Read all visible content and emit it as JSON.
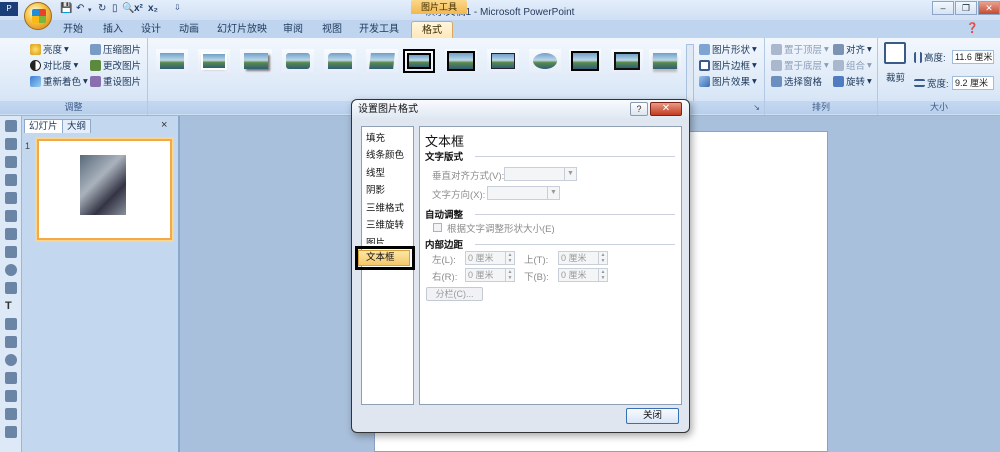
{
  "app": {
    "title": "演示文稿1 - Microsoft PowerPoint",
    "tool_context": "图片工具"
  },
  "tabs": [
    {
      "label": "开始"
    },
    {
      "label": "插入"
    },
    {
      "label": "设计"
    },
    {
      "label": "动画"
    },
    {
      "label": "幻灯片放映"
    },
    {
      "label": "审阅"
    },
    {
      "label": "视图"
    },
    {
      "label": "开发工具"
    },
    {
      "label": "格式",
      "active": true
    }
  ],
  "ribbon": {
    "adjust": {
      "label": "调整",
      "brightness": "亮度",
      "contrast": "对比度",
      "recolor": "重新着色",
      "compress": "压缩图片",
      "change": "更改图片",
      "reset": "重设图片"
    },
    "picture_styles": {
      "shape": "图片形状",
      "border": "图片边框",
      "effects": "图片效果"
    },
    "arrange": {
      "label": "排列",
      "bring_front": "置于顶层",
      "send_back": "置于底层",
      "selection_pane": "选择窗格",
      "align": "对齐",
      "group": "组合",
      "rotate": "旋转"
    },
    "size": {
      "label": "大小",
      "crop": "裁剪",
      "height_label": "高度:",
      "height_value": "11.6 厘米",
      "width_label": "宽度:",
      "width_value": "9.2 厘米"
    }
  },
  "slides_pane": {
    "tab_slides": "幻灯片",
    "tab_outline": "大纲",
    "close": "×",
    "slide_number": "1"
  },
  "dialog": {
    "title": "设置图片格式",
    "help": "?",
    "close_x": "✕",
    "nav": [
      "填充",
      "线条颜色",
      "线型",
      "阴影",
      "三维格式",
      "三维旋转",
      "图片",
      "文本框"
    ],
    "selected_nav": "文本框",
    "panel": {
      "heading": "文本框",
      "layout_section": "文字版式",
      "vertical_align_label": "垂直对齐方式(V):",
      "vertical_align_value": "",
      "text_direction_label": "文字方向(X):",
      "text_direction_value": "",
      "autofit_section": "自动调整",
      "autofit_checkbox": "根据文字调整形状大小(E)",
      "autofit_checked": false,
      "margins_section": "内部边距",
      "left_label": "左(L):",
      "left_value": "0 厘米",
      "top_label": "上(T):",
      "top_value": "0 厘米",
      "right_label": "右(R):",
      "right_value": "0 厘米",
      "bottom_label": "下(B):",
      "bottom_value": "0 厘米",
      "columns_button": "分栏(C)..."
    },
    "close_button": "关闭"
  }
}
